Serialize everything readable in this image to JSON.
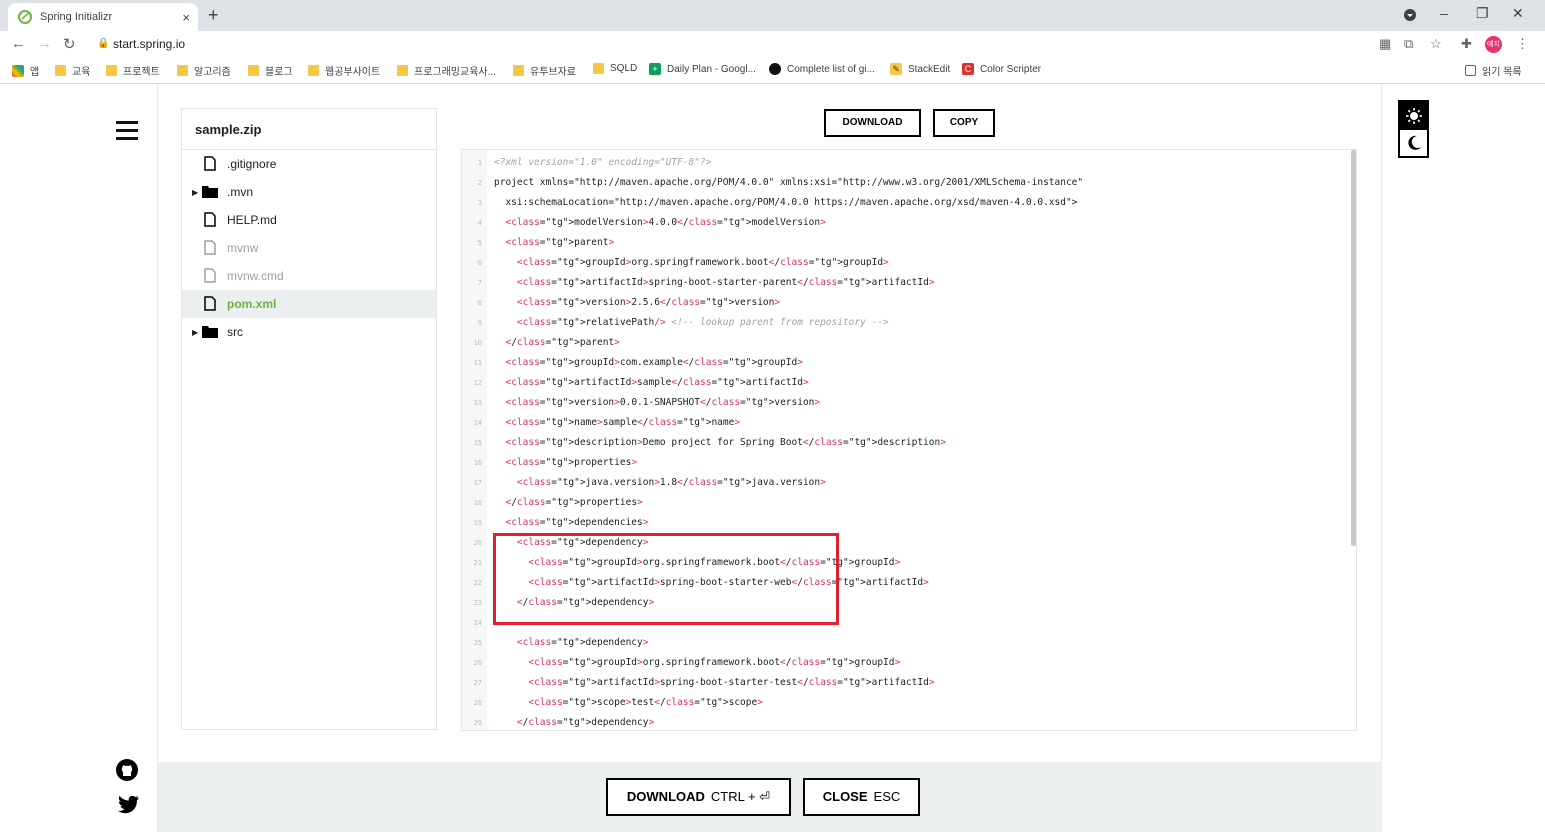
{
  "browser": {
    "tab_title": "Spring Initializr",
    "tab_close": "×",
    "new_tab": "+",
    "url": "start.spring.io",
    "profile_initials": "예지",
    "reading_list": "읽기 목록",
    "bookmarks": [
      "앱",
      "교육",
      "프로젝트",
      "알고리즘",
      "블로그",
      "웹공부사이트",
      "프로그래밍교육사...",
      "유투브자료",
      "SQLD",
      "Daily Plan - Googl...",
      "Complete list of gi...",
      "StackEdit",
      "Color Scripter"
    ]
  },
  "tree": {
    "title": "sample.zip",
    "items": [
      {
        "name": ".gitignore",
        "type": "file"
      },
      {
        "name": ".mvn",
        "type": "folder"
      },
      {
        "name": "HELP.md",
        "type": "file"
      },
      {
        "name": "mvnw",
        "type": "file"
      },
      {
        "name": "mvnw.cmd",
        "type": "file"
      },
      {
        "name": "pom.xml",
        "type": "file"
      },
      {
        "name": "src",
        "type": "folder"
      }
    ]
  },
  "top_buttons": {
    "download": "DOWNLOAD",
    "copy": "COPY"
  },
  "footer": {
    "download_label": "DOWNLOAD",
    "download_shortcut": "CTRL + ⏎",
    "close_label": "CLOSE",
    "close_shortcut": "ESC"
  },
  "code": {
    "line_numbers": [
      "1",
      "2",
      "3",
      "4",
      "5",
      "6",
      "7",
      "8",
      "9",
      "10",
      "11",
      "12",
      "13",
      "14",
      "15",
      "16",
      "17",
      "18",
      "19",
      "20",
      "21",
      "22",
      "23",
      "24",
      "25",
      "26",
      "27",
      "28",
      "29"
    ],
    "lines": [
      "<?xml version=\"1.0\" encoding=\"UTF-8\"?>",
      "<project xmlns=\"http://maven.apache.org/POM/4.0.0\" xmlns:xsi=\"http://www.w3.org/2001/XMLSchema-instance\"",
      "  xsi:schemaLocation=\"http://maven.apache.org/POM/4.0.0 https://maven.apache.org/xsd/maven-4.0.0.xsd\">",
      "  <modelVersion>4.0.0</modelVersion>",
      "  <parent>",
      "    <groupId>org.springframework.boot</groupId>",
      "    <artifactId>spring-boot-starter-parent</artifactId>",
      "    <version>2.5.6</version>",
      "    <relativePath/> <!-- lookup parent from repository -->",
      "  </parent>",
      "  <groupId>com.example</groupId>",
      "  <artifactId>sample</artifactId>",
      "  <version>0.0.1-SNAPSHOT</version>",
      "  <name>sample</name>",
      "  <description>Demo project for Spring Boot</description>",
      "  <properties>",
      "    <java.version>1.8</java.version>",
      "  </properties>",
      "  <dependencies>",
      "    <dependency>",
      "      <groupId>org.springframework.boot</groupId>",
      "      <artifactId>spring-boot-starter-web</artifactId>",
      "    </dependency>",
      "",
      "    <dependency>",
      "      <groupId>org.springframework.boot</groupId>",
      "      <artifactId>spring-boot-starter-test</artifactId>",
      "      <scope>test</scope>",
      "    </dependency>"
    ]
  },
  "colors": {
    "accent": "#6db33f",
    "tag": "#d2336c",
    "highlight": "#e0202e"
  }
}
